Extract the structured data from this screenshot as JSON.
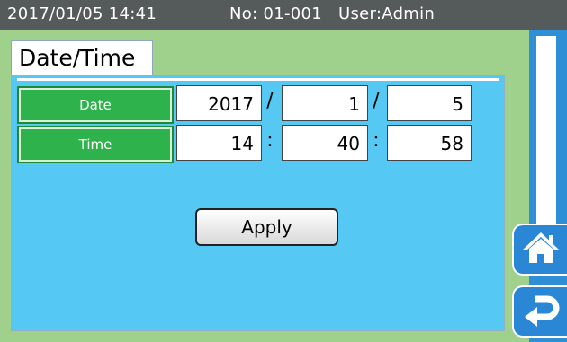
{
  "header": {
    "datetime": "2017/01/05 14:41",
    "number": "No: 01-001",
    "user": "User:Admin"
  },
  "tab": {
    "title": "Date/Time"
  },
  "date_row": {
    "label": "Date",
    "year": "2017",
    "month": "1",
    "day": "5",
    "separator": "/"
  },
  "time_row": {
    "label": "Time",
    "hour": "14",
    "minute": "40",
    "second": "58",
    "separator": ":"
  },
  "apply_button": {
    "label": "Apply"
  },
  "nav": {
    "home_icon": "home-icon",
    "back_icon": "return-arrow-icon"
  },
  "colors": {
    "header_bg": "#555a5a",
    "background": "#9fd08c",
    "panel": "#55c8f4",
    "label_green": "#2eb34c",
    "nav_blue": "#2a87d6"
  }
}
